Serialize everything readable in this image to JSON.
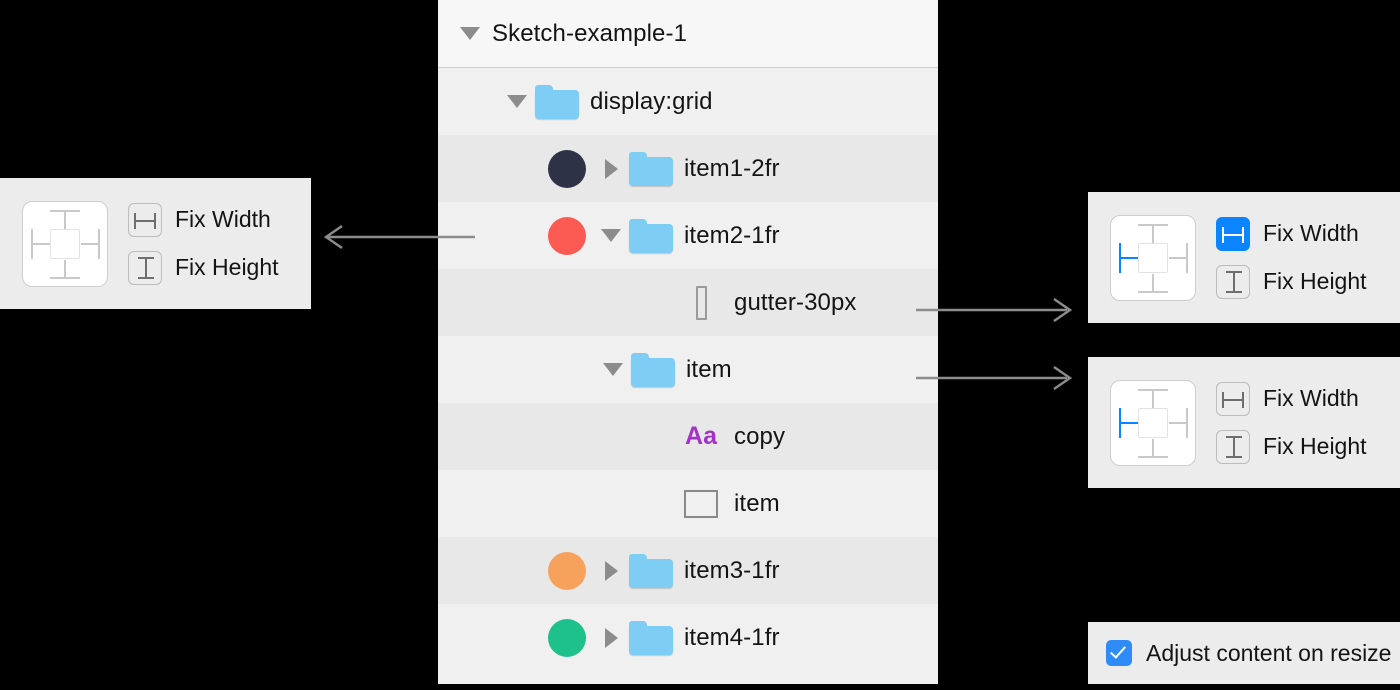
{
  "layer_list": {
    "header": {
      "title": "Sketch-example-1",
      "disclosure": "triangle-down-icon"
    },
    "rows": [
      {
        "label": "display:grid",
        "icon": "folder-icon",
        "disclosure": "triangle-down-icon",
        "indent": 1,
        "dot": null
      },
      {
        "label": "item1-2fr",
        "icon": "folder-icon",
        "disclosure": "triangle-right-icon",
        "indent": 2,
        "dot": "#2e3246"
      },
      {
        "label": "item2-1fr",
        "icon": "folder-icon",
        "disclosure": "triangle-down-icon",
        "indent": 2,
        "dot": "#fb5b52"
      },
      {
        "label": "gutter-30px",
        "icon": "gutter-bar-icon",
        "disclosure": null,
        "indent": 4,
        "dot": null
      },
      {
        "label": "item",
        "icon": "folder-icon",
        "disclosure": "triangle-down-icon",
        "indent": 3,
        "dot": null
      },
      {
        "label": "copy",
        "icon": "text-aa-icon",
        "icon_text": "Aa",
        "disclosure": null,
        "indent": 4,
        "dot": null
      },
      {
        "label": "item",
        "icon": "rectangle-shape-icon",
        "disclosure": null,
        "indent": 4,
        "dot": null
      },
      {
        "label": "item3-1fr",
        "icon": "folder-icon",
        "disclosure": "triangle-right-icon",
        "indent": 2,
        "dot": "#f7a25c"
      },
      {
        "label": "item4-1fr",
        "icon": "folder-icon",
        "disclosure": "triangle-right-icon",
        "indent": 2,
        "dot": "#1ec08c"
      }
    ]
  },
  "panel_left": {
    "fix_width_label": "Fix Width",
    "fix_height_label": "Fix Height",
    "fix_width_active": false,
    "fix_height_active": false,
    "pins": {
      "top": false,
      "right": false,
      "bottom": false,
      "left": false
    }
  },
  "panel_right_1": {
    "fix_width_label": "Fix Width",
    "fix_height_label": "Fix Height",
    "fix_width_active": true,
    "fix_height_active": false,
    "pins": {
      "top": false,
      "right": false,
      "bottom": false,
      "left": true
    }
  },
  "panel_right_2": {
    "fix_width_label": "Fix Width",
    "fix_height_label": "Fix Height",
    "fix_width_active": false,
    "fix_height_active": false,
    "pins": {
      "top": false,
      "right": false,
      "bottom": false,
      "left": true
    }
  },
  "checkbox_panel": {
    "label": "Adjust content on resize",
    "checked": true
  },
  "colors": {
    "accent_blue": "#0a84ff",
    "checkbox_blue": "#2f8cf7",
    "folder_blue": "#7ecdf5",
    "text_icon_purple": "#a333c8",
    "arrow_gray": "#8c8c8c",
    "row_alt": "#e8e8e8",
    "row_plain": "#f0f0f0",
    "panel_bg": "#ececec"
  },
  "arrows": [
    {
      "name": "arrow-to-left-panel",
      "direction": "left"
    },
    {
      "name": "arrow-to-right-panel-1",
      "direction": "right"
    },
    {
      "name": "arrow-to-right-panel-2",
      "direction": "right"
    }
  ]
}
